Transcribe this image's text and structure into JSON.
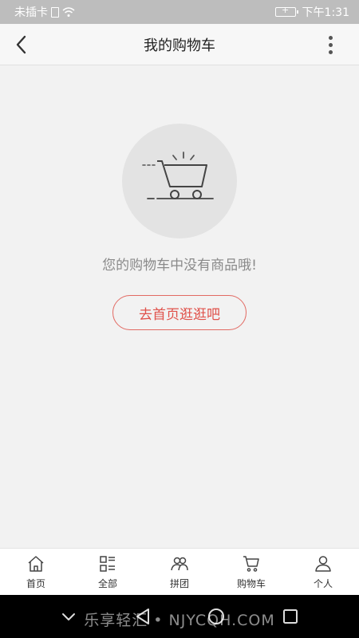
{
  "status_bar": {
    "carrier": "未插卡",
    "time": "下午1:31"
  },
  "header": {
    "title": "我的购物车"
  },
  "empty_state": {
    "message": "您的购物车中没有商品哦!",
    "button_label": "去首页逛逛吧"
  },
  "tab_bar": {
    "items": [
      {
        "label": "首页",
        "icon": "home-icon"
      },
      {
        "label": "全部",
        "icon": "list-icon"
      },
      {
        "label": "拼团",
        "icon": "group-icon"
      },
      {
        "label": "购物车",
        "icon": "cart-icon"
      },
      {
        "label": "个人",
        "icon": "person-icon"
      }
    ]
  },
  "watermark": {
    "text": "乐享轻汇 • NJYCQH.COM"
  },
  "colors": {
    "accent": "#e0524b",
    "background": "#f2f2f2",
    "status_bar": "#bdbdbd"
  }
}
